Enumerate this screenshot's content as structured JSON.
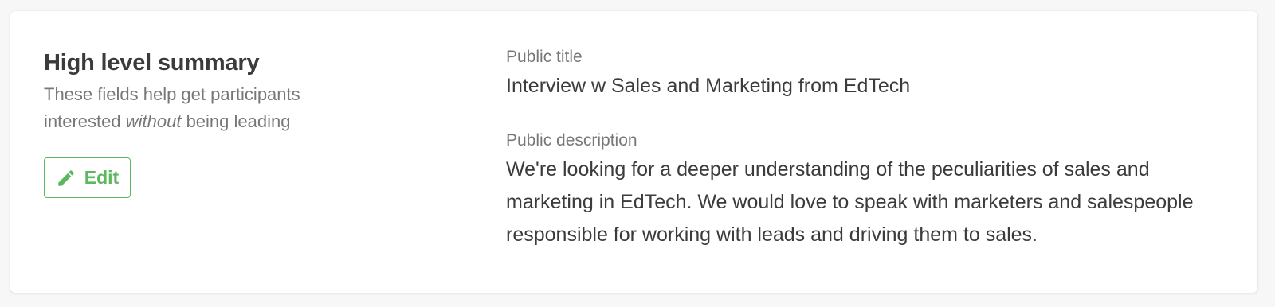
{
  "summary": {
    "title": "High level summary",
    "help_prefix": "These fields help get participants interested ",
    "help_emphasis": "without",
    "help_suffix": " being leading",
    "edit_label": "Edit",
    "edit_icon": "pencil-icon",
    "accent_color": "#5cb85c"
  },
  "fields": {
    "public_title": {
      "label": "Public title",
      "value": "Interview w Sales and Marketing from EdTech"
    },
    "public_description": {
      "label": "Public description",
      "value": "We're looking for a deeper understanding of the peculiarities of sales and marketing in EdTech. We would love to speak with marketers and salespeople responsible for working with leads and driving them to sales."
    }
  }
}
